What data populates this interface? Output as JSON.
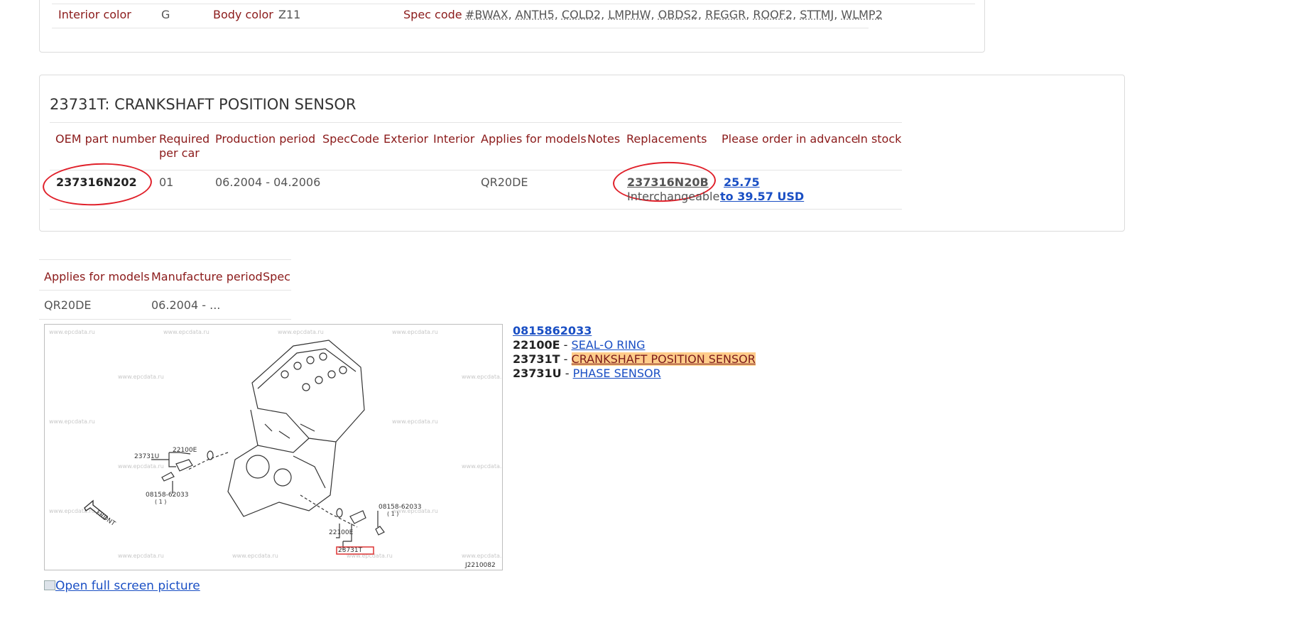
{
  "vehicle_info": {
    "interior_color_label": "Interior color",
    "interior_color_value": "G",
    "body_color_label": "Body color",
    "body_color_value": "Z11",
    "spec_code_label": "Spec code",
    "spec_codes": [
      "#BWAX",
      "ANTH5",
      "COLD2",
      "LMPHW",
      "OBDS2",
      "REGGR",
      "ROOF2",
      "STTMJ",
      "WLMP2"
    ]
  },
  "part_section": {
    "title": "23731T: CRANKSHAFT POSITION SENSOR",
    "headers": {
      "oem": "OEM part number",
      "required_1": "Required",
      "required_2": "per car",
      "production": "Production period",
      "speccode": "SpecCode",
      "exterior": "Exterior",
      "interior": "Interior",
      "applies": "Applies for models",
      "notes": "Notes",
      "replacements": "Replacements",
      "order": "Please order in advance",
      "stock": "In stock"
    },
    "row": {
      "oem": "237316N202",
      "required": "01",
      "production": "06.2004 - 04.2006",
      "applies": "QR20DE",
      "replacement": "237316N20B",
      "replacement_note": "Interchangeable",
      "price_from": "25.75",
      "price_to": "to 39.57 USD"
    }
  },
  "applies_section": {
    "headers": {
      "applies": "Applies for models",
      "manufacture": "Manufacture period",
      "spec": "Spec"
    },
    "row": {
      "model": "QR20DE",
      "period": "06.2004 - ..."
    }
  },
  "diagram": {
    "watermark": "www.epcdata.ru",
    "code": "J2210082",
    "labels": {
      "a": "23731U",
      "b": "22100E",
      "c": "08158-62033",
      "c_qty": "( 1 )",
      "d": "08158-62033",
      "d_qty": "( 1 )",
      "e": "22100E",
      "f": "23731T",
      "front": "FRONT"
    },
    "open_full_link": "Open full screen picture"
  },
  "legend": {
    "top_link": "0815862033",
    "items": [
      {
        "code": "22100E",
        "sep": " - ",
        "name": "SEAL-O RING"
      },
      {
        "code": "23731T",
        "sep": " - ",
        "name": "CRANKSHAFT POSITION SENSOR"
      },
      {
        "code": "23731U",
        "sep": " - ",
        "name": "PHASE SENSOR"
      }
    ]
  },
  "colors": {
    "header_text": "#8b1a1a",
    "link": "#1a4fc4",
    "annotation_circle": "#e0202a",
    "highlight": "#ffcc8a"
  }
}
